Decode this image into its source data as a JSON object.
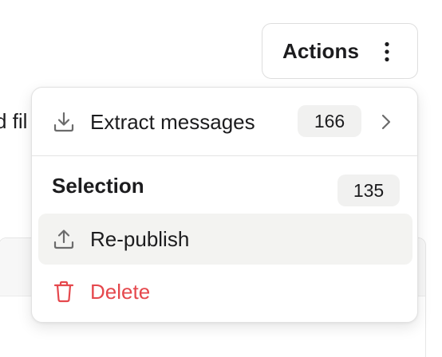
{
  "background": {
    "text_fragment": "d fil"
  },
  "actions_button": {
    "label": "Actions",
    "icon": "kebab-vertical-icon"
  },
  "menu": {
    "extract": {
      "label": "Extract messages",
      "count": "166",
      "icon": "download-icon",
      "submenu_icon": "chevron-right-icon"
    },
    "selection": {
      "title": "Selection",
      "count": "135",
      "items": [
        {
          "label": "Re-publish",
          "icon": "upload-icon",
          "highlighted": true
        },
        {
          "label": "Delete",
          "icon": "trash-icon",
          "color": "#e5484d"
        }
      ]
    }
  },
  "colors": {
    "danger": "#e5484d",
    "hover_bg": "#f3f3f1",
    "badge_bg": "#f1f1f0",
    "icon_gray": "#6b6b6b"
  }
}
